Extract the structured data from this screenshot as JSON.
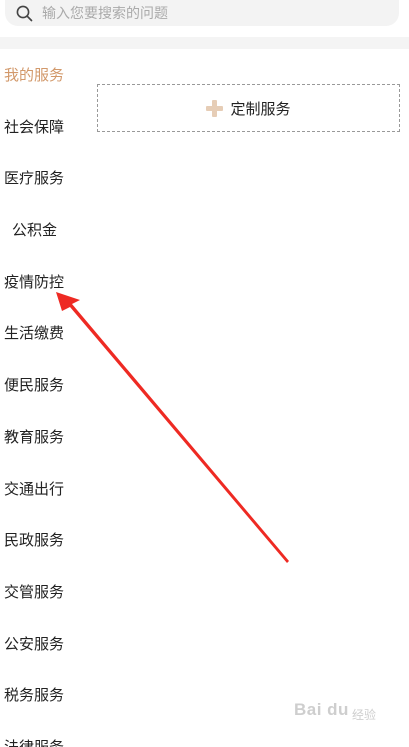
{
  "search": {
    "placeholder": "输入您要搜索的问题",
    "icon": "search-icon"
  },
  "categories": [
    {
      "label": "我的服务",
      "active": true
    },
    {
      "label": "社会保障"
    },
    {
      "label": "医疗服务"
    },
    {
      "label": "公积金"
    },
    {
      "label": "疫情防控"
    },
    {
      "label": "生活缴费"
    },
    {
      "label": "便民服务"
    },
    {
      "label": "教育服务"
    },
    {
      "label": "交通出行"
    },
    {
      "label": "民政服务"
    },
    {
      "label": "交管服务"
    },
    {
      "label": "公安服务"
    },
    {
      "label": "税务服务"
    },
    {
      "label": "法律服务"
    }
  ],
  "custom_service": {
    "label": "定制服务",
    "icon": "plus-icon"
  },
  "colors": {
    "active": "#d2996b",
    "plus": "#e6cdb6",
    "arrow": "#ee2a23"
  },
  "watermark": {
    "brand": "Bai du",
    "sub": "经验"
  }
}
